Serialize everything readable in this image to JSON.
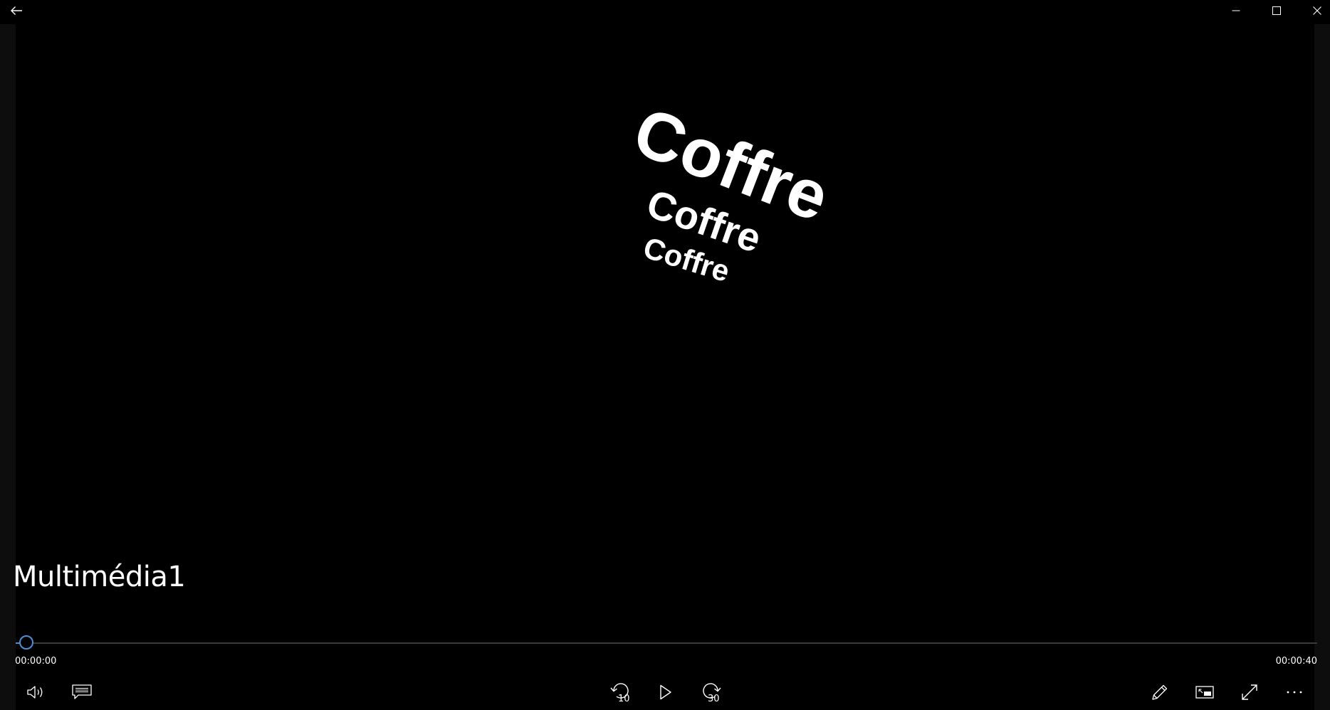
{
  "window": {
    "back_icon": "arrow-left-icon",
    "minimize_icon": "minimize-icon",
    "maximize_icon": "maximize-icon",
    "close_icon": "close-icon"
  },
  "video": {
    "overlay_texts": [
      "Coffre",
      "Coffre",
      "Coffre"
    ]
  },
  "media": {
    "title": "Multimédia1"
  },
  "playback": {
    "current_time": "00:00:00",
    "total_time": "00:00:40",
    "progress": 0.0,
    "accent_color": "#4a90d9"
  },
  "controls": {
    "left": [
      {
        "id": "volume",
        "icon": "volume-icon"
      },
      {
        "id": "captions",
        "icon": "captions-icon"
      }
    ],
    "center": [
      {
        "id": "skip-back",
        "icon": "skip-back-icon",
        "label": "10"
      },
      {
        "id": "play",
        "icon": "play-icon"
      },
      {
        "id": "skip-forward",
        "icon": "skip-forward-icon",
        "label": "30"
      }
    ],
    "right": [
      {
        "id": "edit",
        "icon": "pencil-icon"
      },
      {
        "id": "mini-view",
        "icon": "mini-view-icon"
      },
      {
        "id": "full-screen",
        "icon": "full-screen-icon"
      },
      {
        "id": "more",
        "icon": "more-icon"
      }
    ]
  }
}
